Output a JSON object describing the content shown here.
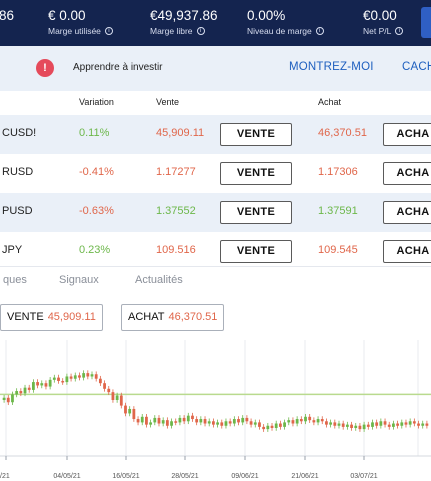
{
  "topbar": {
    "stats": [
      {
        "value": "86",
        "label": ""
      },
      {
        "value": "€ 0.00",
        "label": "Marge utilisée"
      },
      {
        "value": "€49,937.86",
        "label": "Marge libre"
      },
      {
        "value": "0.00%",
        "label": "Niveau de marge"
      },
      {
        "value": "€0.00",
        "label": "Net P/L"
      }
    ]
  },
  "learn_bar": {
    "alert": "!",
    "text": "Apprendre à investir",
    "show_link": "MONTREZ-MOI",
    "hide_link": "CACH"
  },
  "table": {
    "headers": {
      "variation": "Variation",
      "sell": "Vente",
      "buy": "Achat"
    },
    "rows": [
      {
        "symbol": "CUSD!",
        "change": "0.11%",
        "change_dir": "up",
        "sell": "45,909.11",
        "sell_dir": "down",
        "sell_label": "VENTE",
        "buy": "46,370.51",
        "buy_dir": "down",
        "buy_label": "ACHA"
      },
      {
        "symbol": "RUSD",
        "change": "-0.41%",
        "change_dir": "down",
        "sell": "1.17277",
        "sell_dir": "down",
        "sell_label": "VENTE",
        "buy": "1.17306",
        "buy_dir": "down",
        "buy_label": "ACHA"
      },
      {
        "symbol": "PUSD",
        "change": "-0.63%",
        "change_dir": "down",
        "sell": "1.37552",
        "sell_dir": "up",
        "sell_label": "VENTE",
        "buy": "1.37591",
        "buy_dir": "up",
        "buy_label": "ACHA"
      },
      {
        "symbol": "JPY",
        "change": "0.23%",
        "change_dir": "up",
        "sell": "109.516",
        "sell_dir": "down",
        "sell_label": "VENTE",
        "buy": "109.545",
        "buy_dir": "down",
        "buy_label": "ACHA"
      }
    ]
  },
  "tabs": [
    "ques",
    "Signaux",
    "Actualités"
  ],
  "trade": {
    "sell_label": "VENTE",
    "sell_price": "45,909.11",
    "buy_label": "ACHAT",
    "buy_price": "46,370.51"
  },
  "chart_data": {
    "type": "candlestick",
    "x_ticks": [
      "/21",
      "04/05/21",
      "16/05/21",
      "28/05/21",
      "09/06/21",
      "21/06/21",
      "03/07/21"
    ],
    "reference_level": 0.55,
    "series_note": "",
    "closes": [
      0.52,
      0.48,
      0.55,
      0.58,
      0.56,
      0.61,
      0.59,
      0.66,
      0.63,
      0.65,
      0.62,
      0.68,
      0.7,
      0.67,
      0.66,
      0.71,
      0.69,
      0.72,
      0.7,
      0.74,
      0.71,
      0.73,
      0.69,
      0.65,
      0.6,
      0.57,
      0.5,
      0.54,
      0.45,
      0.38,
      0.42,
      0.33,
      0.3,
      0.35,
      0.28,
      0.3,
      0.34,
      0.29,
      0.32,
      0.27,
      0.31,
      0.3,
      0.34,
      0.31,
      0.36,
      0.33,
      0.3,
      0.33,
      0.29,
      0.31,
      0.28,
      0.3,
      0.27,
      0.31,
      0.29,
      0.33,
      0.3,
      0.34,
      0.31,
      0.28,
      0.3,
      0.26,
      0.24,
      0.27,
      0.25,
      0.29,
      0.26,
      0.3,
      0.32,
      0.29,
      0.33,
      0.31,
      0.35,
      0.32,
      0.3,
      0.33,
      0.31,
      0.28,
      0.3,
      0.27,
      0.29,
      0.26,
      0.28,
      0.25,
      0.27,
      0.24,
      0.28,
      0.26,
      0.3,
      0.27,
      0.31,
      0.28,
      0.26,
      0.29,
      0.27,
      0.3,
      0.28,
      0.31,
      0.29,
      0.27,
      0.29,
      0.27
    ]
  },
  "colors": {
    "topbar": "#14244f",
    "positive": "#6cb74a",
    "negative": "#e0664a",
    "link": "#1e5fbf",
    "alert": "#e54a5b",
    "reference_line": "#b9da8e"
  }
}
